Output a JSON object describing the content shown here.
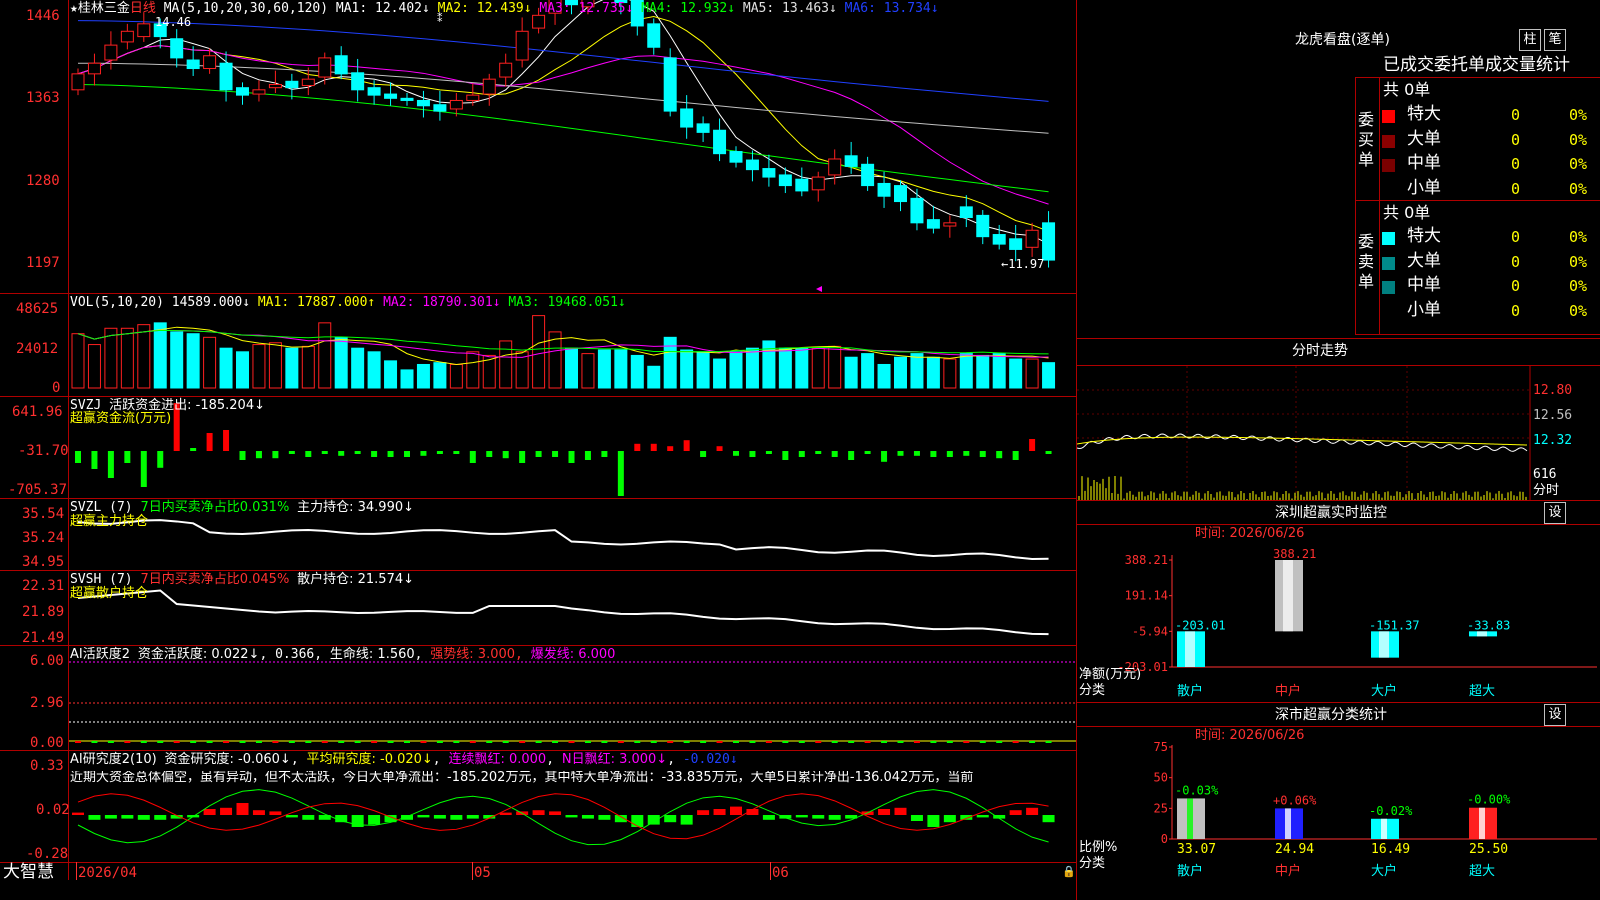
{
  "colors": {
    "up": "#ff2020",
    "down": "#00ffff",
    "border": "#b00000",
    "axis": "#ff3030",
    "ma1": "#ffffff",
    "ma2": "#ffff00",
    "ma3": "#ff00ff",
    "ma4": "#00ff00",
    "ma5": "#c0c0c0",
    "ma6": "#2040ff",
    "green": "#00ff00",
    "yellow": "#ffff00"
  },
  "main": {
    "star": "★",
    "name": "桂林三金",
    "period": "日线",
    "ma_label": "MA(5,10,20,30,60,120)",
    "ma1": "MA1: 12.402↓",
    "ma2": "MA2: 12.439↓",
    "ma3": "MA3: 12.735↓",
    "ma4": "MA4: 12.932↓",
    "ma5": "MA5: 13.463↓",
    "ma6": "MA6: 13.734↓",
    "high_mark": "14.46",
    "low_mark": "←11.97",
    "yticks": [
      "1446",
      "1363",
      "1280",
      "1197"
    ]
  },
  "vol": {
    "label": "VOL(5,10,20)",
    "val": "14589.000↓",
    "ma1": "MA1: 17887.000↑",
    "ma2": "MA2: 18790.301↓",
    "ma3": "MA3: 19468.051↓",
    "yticks": [
      "48625",
      "24012",
      "0"
    ]
  },
  "svzj": {
    "label": "SVZJ",
    "title": "活跃资金进出: -185.204↓",
    "sub": "超赢资金流(万元)",
    "yticks": [
      "641.96",
      "-31.70",
      "-705.37"
    ]
  },
  "svzl": {
    "label": "SVZL (7)",
    "pct": "7日内买卖净占比0.031%",
    "hold": "主力持仓: 34.990↓",
    "sub": "超赢主力持仓",
    "yticks": [
      "35.54",
      "35.24",
      "34.95"
    ]
  },
  "svsh": {
    "label": "SVSH (7)",
    "pct": "7日内买卖净占比0.045%",
    "hold": "散户持仓: 21.574↓",
    "sub": "超赢散户持仓",
    "yticks": [
      "22.31",
      "21.89",
      "21.49"
    ]
  },
  "ai1": {
    "label": "AI活跃度2",
    "a": "资金活跃度: 0.022↓",
    "b": "0.366",
    "c": "生命线: 1.560",
    "d": "强势线: 3.000",
    "e": "爆发线: 6.000",
    "yticks": [
      "6.00",
      "2.96",
      "0.00"
    ]
  },
  "ai2": {
    "label": "AI研究度2(10)",
    "a": "资金研究度: -0.060↓",
    "b": "平均研究度: -0.020↓",
    "c": "连续飘红: 0.000",
    "d": "N日飘红: 3.000↓",
    "e": "-0.020↓",
    "note": "近期大资金总体偏空，虽有异动，但不太活跃，今日大单净流出：-185.202万元，其中特大单净流出：-33.835万元，大单5日累计净出-136.042万元，当前",
    "yticks": [
      "0.33",
      "0.02",
      "-0.28"
    ]
  },
  "xaxis": {
    "d1": "2026/04",
    "d2": "05",
    "d3": "06"
  },
  "footer": {
    "brand": "大智慧"
  },
  "dragon": {
    "title": "龙虎看盘(逐单)",
    "btn1": "柱",
    "btn2": "笔",
    "header": "已成交委托单成交量统计",
    "buy": {
      "side": "委买单",
      "total": "共 0单",
      "rows": [
        {
          "label": "特大",
          "v": "0",
          "p": "0%"
        },
        {
          "label": "大单",
          "v": "0",
          "p": "0%"
        },
        {
          "label": "中单",
          "v": "0",
          "p": "0%"
        },
        {
          "label": "小单",
          "v": "0",
          "p": "0%"
        }
      ]
    },
    "sell": {
      "side": "委卖单",
      "total": "共 0单",
      "rows": [
        {
          "label": "特大",
          "v": "0",
          "p": "0%"
        },
        {
          "label": "大单",
          "v": "0",
          "p": "0%"
        },
        {
          "label": "中单",
          "v": "0",
          "p": "0%"
        },
        {
          "label": "小单",
          "v": "0",
          "p": "0%"
        }
      ]
    }
  },
  "intraday": {
    "title": "分时走势",
    "y1": "12.80",
    "y2": "12.56",
    "y3": "12.32",
    "vol": "616",
    "label": "分时"
  },
  "monitor": {
    "title": "深圳超赢实时监控",
    "btn": "设",
    "time": "时间: 2026/06/26",
    "yticks": [
      "388.21",
      "191.14",
      "-5.94",
      "-203.01"
    ],
    "ylabel": "净额(万元)",
    "xlabel": "分类",
    "bars": [
      {
        "cat": "散户",
        "v": -203.01,
        "label": "-203.01"
      },
      {
        "cat": "中户",
        "v": 388.21,
        "label": "388.21"
      },
      {
        "cat": "大户",
        "v": -151.37,
        "label": "-151.37"
      },
      {
        "cat": "超大",
        "v": -33.83,
        "label": "-33.83"
      }
    ]
  },
  "stats": {
    "title": "深市超赢分类统计",
    "btn": "设",
    "time": "时间: 2026/06/26",
    "yticks": [
      "75",
      "50",
      "25",
      "0"
    ],
    "ylabel": "比例%",
    "xlabel": "分类",
    "bars": [
      {
        "cat": "散户",
        "v": 33.07,
        "top": "-0.03%",
        "val": "33.07"
      },
      {
        "cat": "中户",
        "v": 24.94,
        "top": "+0.06%",
        "val": "24.94"
      },
      {
        "cat": "大户",
        "v": 16.49,
        "top": "-0.02%",
        "val": "16.49"
      },
      {
        "cat": "超大",
        "v": 25.5,
        "top": "-0.00%",
        "val": "25.50"
      }
    ]
  }
}
